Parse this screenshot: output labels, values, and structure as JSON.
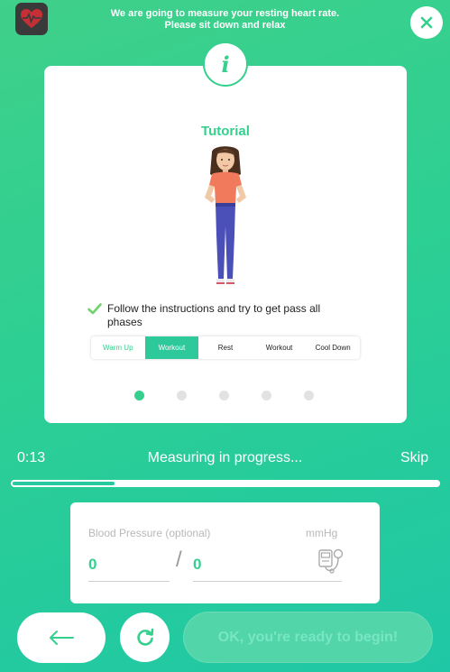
{
  "app_icon": "heart-rate-icon",
  "header": {
    "line1": "We are going to measure your resting heart rate.",
    "line2": "Please sit down and relax"
  },
  "close_icon": "close-icon",
  "card": {
    "info_icon_label": "i",
    "title": "Tutorial",
    "instruction": "Follow the instructions and try to get pass all phases",
    "phases": [
      {
        "label": "Warm Up",
        "state": "done"
      },
      {
        "label": "Workout",
        "state": "active"
      },
      {
        "label": "Rest",
        "state": "pending"
      },
      {
        "label": "Workout",
        "state": "pending"
      },
      {
        "label": "Cool Down",
        "state": "pending"
      }
    ],
    "pager": {
      "count": 5,
      "active_index": 0
    }
  },
  "progress": {
    "timer": "0:13",
    "status": "Measuring in progress...",
    "skip_label": "Skip",
    "fraction": 0.24
  },
  "blood_pressure": {
    "label": "Blood Pressure (optional)",
    "unit": "mmHg",
    "systolic": "0",
    "diastolic": "0",
    "separator": "/"
  },
  "footer": {
    "back_icon": "arrow-left-icon",
    "refresh_icon": "refresh-icon",
    "ok_label": "OK, you're ready to begin!"
  },
  "colors": {
    "accent": "#35cf8e",
    "active_phase": "#2ec99a",
    "ok_button_bg": "#52d5a9"
  }
}
